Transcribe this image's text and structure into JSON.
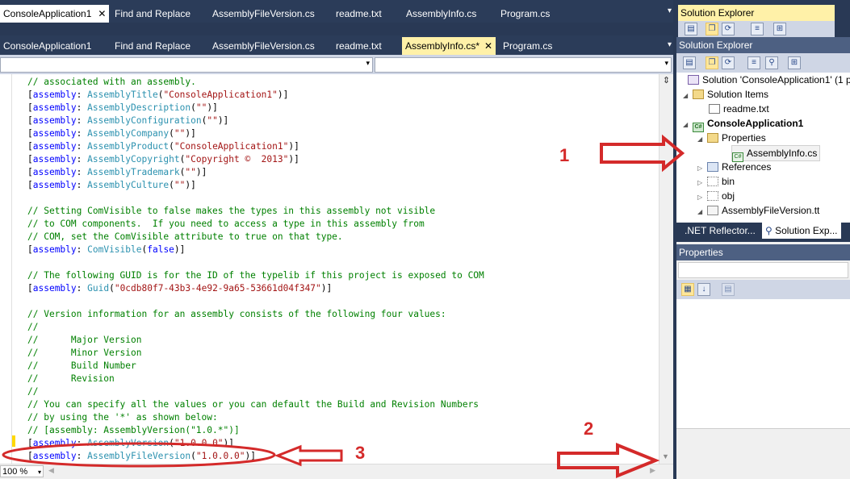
{
  "ghost_tabs": [
    "ConsoleApplication1",
    "Find and Replace",
    "AssemblyFileVersion.cs",
    "readme.txt",
    "AssemblyInfo.cs",
    "Program.cs"
  ],
  "ghost_close": "✕",
  "tabs": [
    "ConsoleApplication1",
    "Find and Replace",
    "AssemblyFileVersion.cs",
    "readme.txt",
    "AssemblyInfo.cs*",
    "Program.cs"
  ],
  "tab_close": "✕",
  "dropdown_glyph": "▾",
  "code_lines": [
    [
      [
        "cm",
        "// associated with an assembly."
      ]
    ],
    [
      [
        "",
        "["
      ],
      [
        "kw",
        "assembly"
      ],
      [
        "",
        ": "
      ],
      [
        "ty",
        "AssemblyTitle"
      ],
      [
        "",
        "("
      ],
      [
        "st",
        "\"ConsoleApplication1\""
      ],
      [
        "",
        ")]"
      ]
    ],
    [
      [
        "",
        "["
      ],
      [
        "kw",
        "assembly"
      ],
      [
        "",
        ": "
      ],
      [
        "ty",
        "AssemblyDescription"
      ],
      [
        "",
        "("
      ],
      [
        "st",
        "\"\""
      ],
      [
        "",
        ")]"
      ]
    ],
    [
      [
        "",
        "["
      ],
      [
        "kw",
        "assembly"
      ],
      [
        "",
        ": "
      ],
      [
        "ty",
        "AssemblyConfiguration"
      ],
      [
        "",
        "("
      ],
      [
        "st",
        "\"\""
      ],
      [
        "",
        ")]"
      ]
    ],
    [
      [
        "",
        "["
      ],
      [
        "kw",
        "assembly"
      ],
      [
        "",
        ": "
      ],
      [
        "ty",
        "AssemblyCompany"
      ],
      [
        "",
        "("
      ],
      [
        "st",
        "\"\""
      ],
      [
        "",
        ")]"
      ]
    ],
    [
      [
        "",
        "["
      ],
      [
        "kw",
        "assembly"
      ],
      [
        "",
        ": "
      ],
      [
        "ty",
        "AssemblyProduct"
      ],
      [
        "",
        "("
      ],
      [
        "st",
        "\"ConsoleApplication1\""
      ],
      [
        "",
        ")]"
      ]
    ],
    [
      [
        "",
        "["
      ],
      [
        "kw",
        "assembly"
      ],
      [
        "",
        ": "
      ],
      [
        "ty",
        "AssemblyCopyright"
      ],
      [
        "",
        "("
      ],
      [
        "st",
        "\"Copyright ©  2013\""
      ],
      [
        "",
        ")]"
      ]
    ],
    [
      [
        "",
        "["
      ],
      [
        "kw",
        "assembly"
      ],
      [
        "",
        ": "
      ],
      [
        "ty",
        "AssemblyTrademark"
      ],
      [
        "",
        "("
      ],
      [
        "st",
        "\"\""
      ],
      [
        "",
        ")]"
      ]
    ],
    [
      [
        "",
        "["
      ],
      [
        "kw",
        "assembly"
      ],
      [
        "",
        ": "
      ],
      [
        "ty",
        "AssemblyCulture"
      ],
      [
        "",
        "("
      ],
      [
        "st",
        "\"\""
      ],
      [
        "",
        ")]"
      ]
    ],
    [],
    [
      [
        "cm",
        "// Setting ComVisible to false makes the types in this assembly not visible"
      ]
    ],
    [
      [
        "cm",
        "// to COM components.  If you need to access a type in this assembly from"
      ]
    ],
    [
      [
        "cm",
        "// COM, set the ComVisible attribute to true on that type."
      ]
    ],
    [
      [
        "",
        "["
      ],
      [
        "kw",
        "assembly"
      ],
      [
        "",
        ": "
      ],
      [
        "ty",
        "ComVisible"
      ],
      [
        "",
        "("
      ],
      [
        "kw",
        "false"
      ],
      [
        "",
        ")]"
      ]
    ],
    [],
    [
      [
        "cm",
        "// The following GUID is for the ID of the typelib if this project is exposed to COM"
      ]
    ],
    [
      [
        "",
        "["
      ],
      [
        "kw",
        "assembly"
      ],
      [
        "",
        ": "
      ],
      [
        "ty",
        "Guid"
      ],
      [
        "",
        "("
      ],
      [
        "st",
        "\"0cdb80f7-43b3-4e92-9a65-53661d04f347\""
      ],
      [
        "",
        ")]"
      ]
    ],
    [],
    [
      [
        "cm",
        "// Version information for an assembly consists of the following four values:"
      ]
    ],
    [
      [
        "cm",
        "//"
      ]
    ],
    [
      [
        "cm",
        "//      Major Version"
      ]
    ],
    [
      [
        "cm",
        "//      Minor Version"
      ]
    ],
    [
      [
        "cm",
        "//      Build Number"
      ]
    ],
    [
      [
        "cm",
        "//      Revision"
      ]
    ],
    [
      [
        "cm",
        "//"
      ]
    ],
    [
      [
        "cm",
        "// You can specify all the values or you can default the Build and Revision Numbers"
      ]
    ],
    [
      [
        "cm",
        "// by using the '*' as shown below:"
      ]
    ],
    [
      [
        "cm",
        "// [assembly: AssemblyVersion(\"1.0.*\")]"
      ]
    ],
    [
      [
        "",
        "["
      ],
      [
        "kw",
        "assembly"
      ],
      [
        "",
        ": "
      ],
      [
        "ty",
        "AssemblyVersion"
      ],
      [
        "",
        "("
      ],
      [
        "st",
        "\"1.0.0.0\""
      ],
      [
        "",
        ")]"
      ]
    ],
    [
      [
        "",
        "["
      ],
      [
        "kw",
        "assembly"
      ],
      [
        "",
        ": "
      ],
      [
        "ty",
        "AssemblyFileVersion"
      ],
      [
        "",
        "("
      ],
      [
        "st",
        "\"1.0.0.0\""
      ],
      [
        "",
        ")]"
      ]
    ]
  ],
  "zoom": "100 %",
  "solution_explorer": {
    "title": "Solution Explorer",
    "tree": [
      {
        "label": "Solution 'ConsoleApplication1' (1 p",
        "icon": "solution-icon",
        "exp": "",
        "bold": false
      },
      {
        "label": "Solution Items",
        "icon": "folder-open-icon",
        "exp": "◢",
        "bold": false
      },
      {
        "label": "readme.txt",
        "icon": "text-file-icon",
        "exp": "",
        "bold": false
      },
      {
        "label": "ConsoleApplication1",
        "icon": "csharp-project-icon",
        "exp": "◢",
        "bold": true
      },
      {
        "label": "Properties",
        "icon": "folder-open-icon",
        "exp": "◢",
        "bold": false
      },
      {
        "label": "AssemblyInfo.cs",
        "icon": "csharp-file-icon",
        "exp": "",
        "bold": false,
        "selected": true
      },
      {
        "label": "References",
        "icon": "references-icon",
        "exp": "▷",
        "bold": false
      },
      {
        "label": "bin",
        "icon": "folder-icon",
        "exp": "▷",
        "bold": false
      },
      {
        "label": "obj",
        "icon": "folder-icon",
        "exp": "▷",
        "bold": false
      },
      {
        "label": "AssemblyFileVersion.tt",
        "icon": "template-file-icon",
        "exp": "◢",
        "bold": false
      }
    ]
  },
  "panel_tabs": [
    ".NET Reflector...",
    "Solution Exp..."
  ],
  "properties": {
    "title": "Properties"
  },
  "annotations": [
    "1",
    "2",
    "3"
  ],
  "annotation_color": "#d42a2a"
}
